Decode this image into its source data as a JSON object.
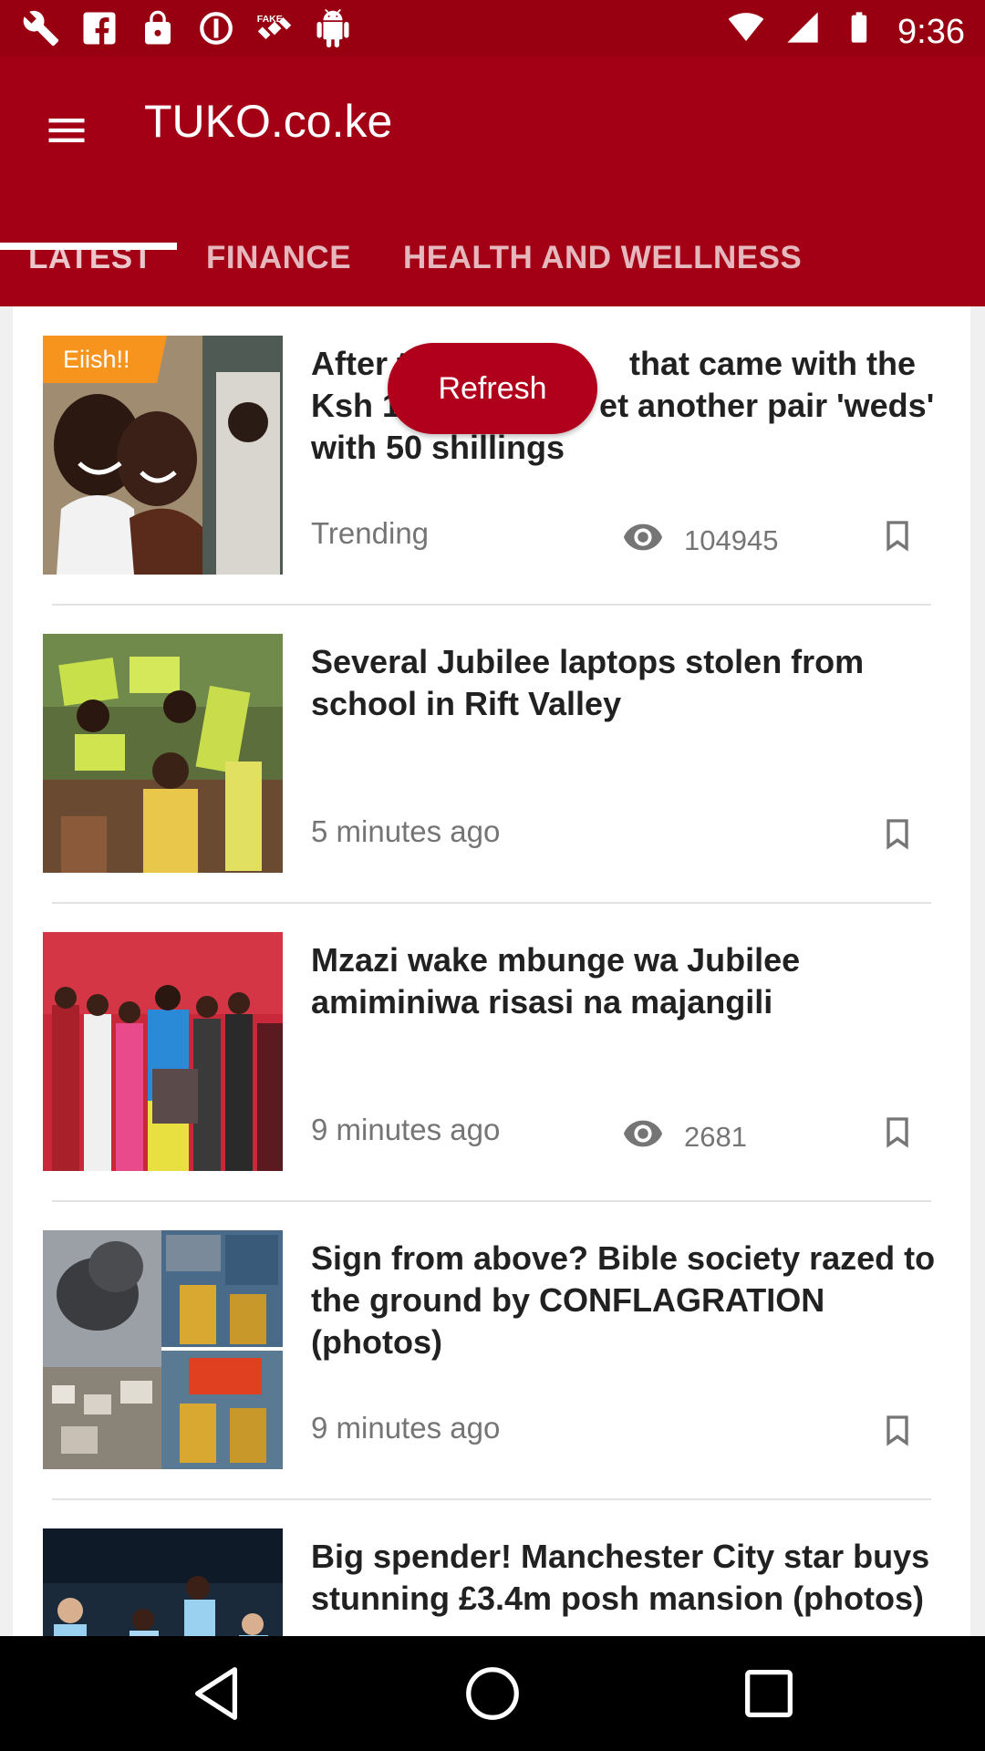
{
  "status_bar": {
    "time": "9:36",
    "icons": [
      "wrench-icon",
      "facebook-icon",
      "lock-icon",
      "blocked-icon",
      "fake-gps-icon",
      "android-icon"
    ]
  },
  "app": {
    "title": "TUKO.co.ke",
    "menu_icon": "menu-icon"
  },
  "tabs": [
    {
      "label": "LATEST",
      "active": true
    },
    {
      "label": "FINANCE",
      "active": false
    },
    {
      "label": "HEALTH AND WELLNESS",
      "active": false
    }
  ],
  "refresh_label": "Refresh",
  "articles": [
    {
      "badge": "Eiish!!",
      "title": "After the wedding that came with the Ksh 100 budget, yet another pair 'weds' with 50 shillings",
      "title_visible": "After [Refresh covered] that came with the Ksh 1... et another pair 'weds' with 50 shillings",
      "time": "Trending",
      "views": "104945"
    },
    {
      "title": "Several Jubilee laptops stolen from school in Rift Valley",
      "time": "5 minutes ago"
    },
    {
      "title": "Mzazi wake mbunge wa Jubilee amiminiwa risasi na majangili",
      "time": "9 minutes ago",
      "views": "2681"
    },
    {
      "title": "Sign from above? Bible society razed to the ground by CONFLAGRATION (photos)",
      "time": "9 minutes ago"
    },
    {
      "title": "Big spender! Manchester City star buys stunning £3.4m posh mansion (photos)"
    }
  ],
  "colors": {
    "brand": "#a30016",
    "status_bar": "#980012",
    "badge": "#f7941d"
  }
}
